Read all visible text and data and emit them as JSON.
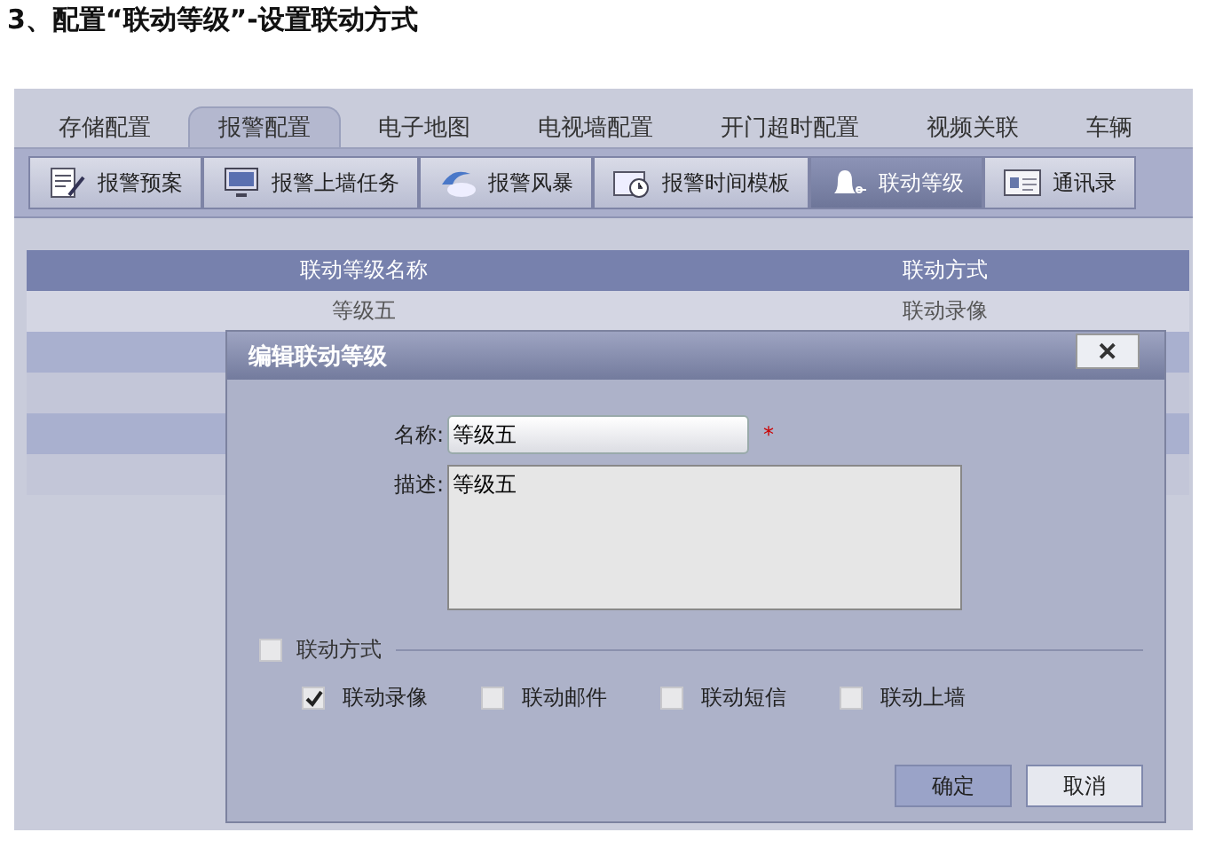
{
  "heading": "3、配置“联动等级”-设置联动方式",
  "tabs": [
    {
      "label": "存储配置",
      "selected": false
    },
    {
      "label": "报警配置",
      "selected": true
    },
    {
      "label": "电子地图",
      "selected": false
    },
    {
      "label": "电视墙配置",
      "selected": false
    },
    {
      "label": "开门超时配置",
      "selected": false
    },
    {
      "label": "视频关联",
      "selected": false
    },
    {
      "label": "车辆",
      "selected": false
    }
  ],
  "toolbar": [
    {
      "label": "报警预案",
      "kind": "plan",
      "selected": false
    },
    {
      "label": "报警上墙任务",
      "kind": "monitor",
      "selected": false
    },
    {
      "label": "报警风暴",
      "kind": "storm",
      "selected": false
    },
    {
      "label": "报警时间模板",
      "kind": "clock",
      "selected": false
    },
    {
      "label": "联动等级",
      "kind": "bell",
      "selected": true
    },
    {
      "label": "通讯录",
      "kind": "contacts",
      "selected": false
    }
  ],
  "table": {
    "columns": [
      "联动等级名称",
      "联动方式"
    ],
    "rows": [
      [
        "等级五",
        "联动录像"
      ]
    ]
  },
  "dialog": {
    "title": "编辑联动等级",
    "close": "✕",
    "name_label": "名称:",
    "name_value": "等级五",
    "required": "*",
    "desc_label": "描述:",
    "desc_value": "等级五",
    "group": {
      "label": "联动方式",
      "checked": false
    },
    "options": [
      {
        "label": "联动录像",
        "checked": true
      },
      {
        "label": "联动邮件",
        "checked": false
      },
      {
        "label": "联动短信",
        "checked": false
      },
      {
        "label": "联动上墙",
        "checked": false
      }
    ],
    "buttons": [
      "确定",
      "取消"
    ]
  }
}
